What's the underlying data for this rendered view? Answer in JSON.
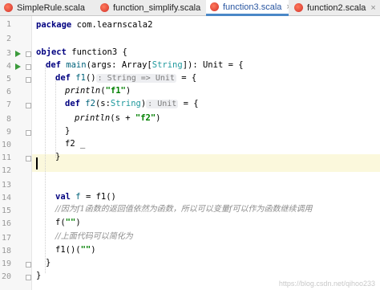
{
  "tabs": [
    {
      "label": "SimpleRule.scala",
      "active": false
    },
    {
      "label": "function_simplify.scala",
      "active": false
    },
    {
      "label": "function3.scala",
      "active": true
    },
    {
      "label": "function2.scala",
      "active": false
    }
  ],
  "tab_close_glyph": "×",
  "line_numbers": [
    "1",
    "2",
    "3",
    "4",
    "5",
    "6",
    "7",
    "8",
    "9",
    "10",
    "11",
    "12",
    "13",
    "14",
    "15",
    "16",
    "17",
    "18",
    "19",
    "20"
  ],
  "code": {
    "l1": {
      "kw": "package",
      "rest": " com.learnscala2"
    },
    "l3": {
      "kw": "object",
      "rest": " function3 {"
    },
    "l4": {
      "kw": "def",
      "name": " main",
      "rest": "(args: Array[",
      "type": "String",
      "rest2": "]): Unit = {"
    },
    "l5": {
      "kw": "def",
      "name": " f1",
      "paren": "()",
      "hint": ": String => Unit",
      "rest": " = {"
    },
    "l6": {
      "call": "println",
      "open": "(",
      "str": "\"f1\"",
      "close": ")"
    },
    "l7": {
      "kw": "def",
      "name": " f2",
      "rest": "(s:",
      "type": "String",
      "rest2": ")",
      "hint": ": Unit",
      "rest3": " = {"
    },
    "l8": {
      "call": "println",
      "open": "(s + ",
      "str": "\"f2\"",
      "close": ")"
    },
    "l9": "}",
    "l10": "f2 _",
    "l11": "}",
    "l14": {
      "kw": "val",
      "name": " f",
      "rest": " = f1()"
    },
    "l15": "//因为f1函数的返回值依然为函数，所以可以变量f可以作为函数继续调用",
    "l16": {
      "pre": "f(",
      "str": "\"\"",
      "post": ")"
    },
    "l17": "//上面代码可以简化为",
    "l18": {
      "pre": "f1()(",
      "str": "\"\"",
      "post": ")"
    },
    "l19": "}",
    "l20": "}"
  },
  "watermark": "https://blog.csdn.net/qihoo233",
  "colors": {
    "keyword": "#000080",
    "string": "#008000",
    "comment": "#8c8c8c",
    "run_icon": "#3c9b3c",
    "active_tab_underline": "#4a88c7"
  },
  "icons": [
    "scala-file-icon",
    "run-gutter-icon",
    "fold-marker-icon",
    "close-tab-icon"
  ]
}
